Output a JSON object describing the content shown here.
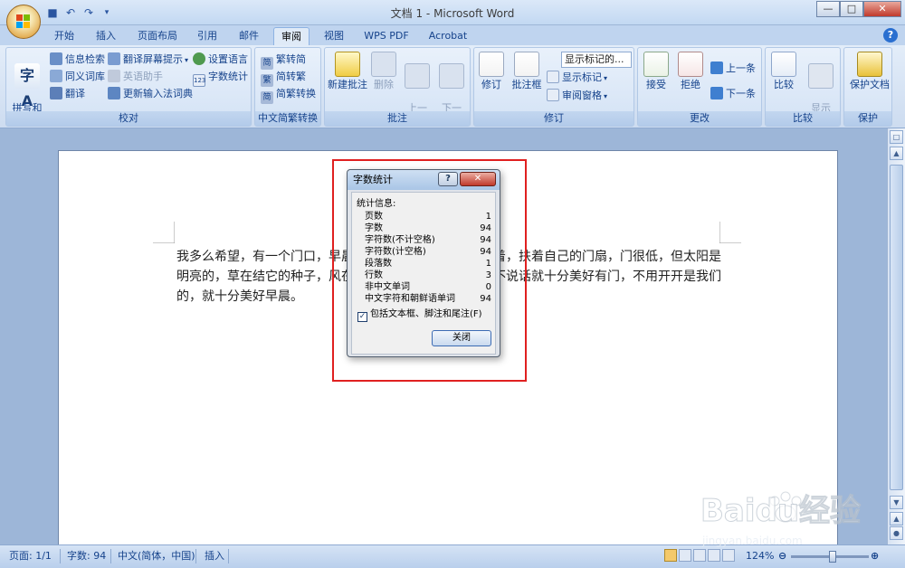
{
  "window": {
    "title": "文档 1 - Microsoft Word",
    "minimize": "—",
    "maximize": "□",
    "close": "✕"
  },
  "tabs": [
    "开始",
    "插入",
    "页面布局",
    "引用",
    "邮件",
    "审阅",
    "视图",
    "WPS PDF",
    "Acrobat"
  ],
  "active_tab": "审阅",
  "ribbon": {
    "proofing": {
      "label": "校对",
      "spelling": "拼写和\n语法",
      "research": "信息检索",
      "thesaurus": "同义词库",
      "translate": "翻译",
      "translate_tip": "翻译屏幕提示",
      "english_assistant": "英语助手",
      "update_ime": "更新输入法词典",
      "set_language": "设置语言",
      "word_count": "字数统计"
    },
    "chinese": {
      "label": "中文简繁转换",
      "to_simplified": "繁转简",
      "to_traditional": "简转繁",
      "convert": "简繁转换"
    },
    "comments": {
      "label": "批注",
      "new": "新建批注",
      "delete": "删除",
      "prev": "上一\n条",
      "next": "下一\n条"
    },
    "tracking": {
      "label": "修订",
      "track": "修订",
      "balloons": "批注框",
      "display_combo": "显示标记的...",
      "show_markup": "显示标记",
      "review_pane": "审阅窗格"
    },
    "changes": {
      "label": "更改",
      "accept": "接受",
      "reject": "拒绝",
      "previous": "上一条",
      "next": "下一条"
    },
    "compare": {
      "label": "比较",
      "compare": "比较",
      "show_source": "显示\n源文档"
    },
    "protect": {
      "label": "保护",
      "protect_doc": "保护文档"
    }
  },
  "document": {
    "text": "我多么希望，有一个门口，早晨，阳光照在草上，我们站着，扶着自己的门扇，门很低，但太阳是明亮的，草在结它的种子，风在摇它的叶子，我们站着，不说话就十分美好有门，不用开开是我们的，就十分美好早晨。"
  },
  "dialog": {
    "title": "字数统计",
    "heading": "统计信息:",
    "stats": [
      {
        "label": "页数",
        "value": "1"
      },
      {
        "label": "字数",
        "value": "94"
      },
      {
        "label": "字符数(不计空格)",
        "value": "94"
      },
      {
        "label": "字符数(计空格)",
        "value": "94"
      },
      {
        "label": "段落数",
        "value": "1"
      },
      {
        "label": "行数",
        "value": "3"
      },
      {
        "label": "非中文单词",
        "value": "0"
      },
      {
        "label": "中文字符和朝鲜语单词",
        "value": "94"
      }
    ],
    "checkbox_label": "包括文本框、脚注和尾注(F)",
    "checkbox_checked": true,
    "close_button": "关闭"
  },
  "status": {
    "page": "页面: 1/1",
    "words": "字数: 94",
    "language": "中文(简体，中国)",
    "insert": "插入",
    "zoom": "124%"
  },
  "watermark": {
    "text": "Baidu经验",
    "url": "jingyan.baidu.com"
  },
  "colors": {
    "highlight": "#e02020",
    "ribbon_text": "#15428b"
  }
}
